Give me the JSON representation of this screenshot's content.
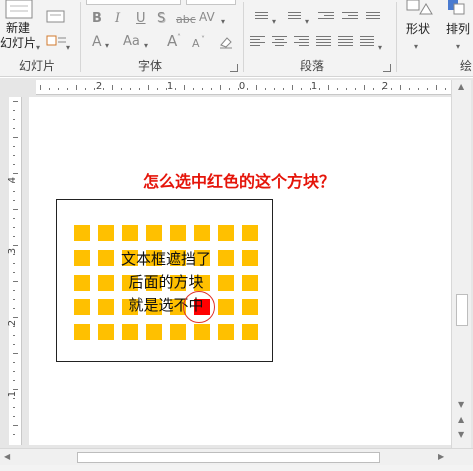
{
  "ribbon": {
    "slides_group": {
      "label": "幻灯片",
      "new_slide_line1": "新建",
      "new_slide_line2": "幻灯片"
    },
    "font_group": {
      "label": "字体",
      "bold": "B",
      "italic": "I",
      "underline": "U",
      "shadow": "S",
      "strike": "abc",
      "spacing": "AV",
      "font_color": "A",
      "change_case": "Aa",
      "grow": "A",
      "shrink": "A"
    },
    "paragraph_group": {
      "label": "段落"
    },
    "drawing_group": {
      "shapes_label": "形状",
      "arrange_label": "排列",
      "partial_label": "绘"
    }
  },
  "ruler": {
    "horizontal_numbers": [
      "2",
      "1",
      "0",
      "1",
      "2"
    ],
    "vertical_numbers": [
      "4",
      "3",
      "2",
      "1"
    ]
  },
  "slide": {
    "title": "怎么选中红色的这个方块？",
    "textbox_lines": [
      "文本框遮挡了",
      "后面的方块",
      "就是选不中"
    ],
    "colors": {
      "square": "#ffc000",
      "target_square": "#ff0000",
      "title": "#e5150a",
      "circle": "#e0312a"
    }
  }
}
